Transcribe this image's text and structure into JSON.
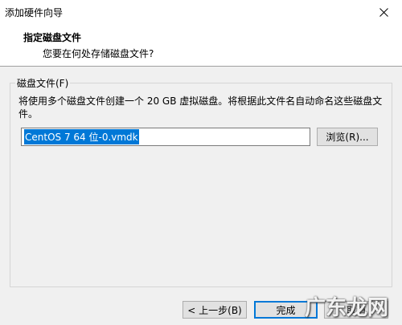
{
  "window": {
    "title": "添加硬件向导",
    "close_icon": "close-icon"
  },
  "header": {
    "title": "指定磁盘文件",
    "subtitle": "您要在何处存储磁盘文件?"
  },
  "disk_file_group": {
    "legend": "磁盘文件(F)",
    "description": "将使用多个磁盘文件创建一个 20 GB 虚拟磁盘。将根据此文件名自动命名这些磁盘文件。",
    "file_name_value": "CentOS 7 64 位-0.vmdk",
    "browse_label": "浏览(R)..."
  },
  "footer": {
    "back_label": "< 上一步(B)",
    "finish_label": "完成",
    "cancel_label": "取消"
  },
  "watermark": {
    "text": "广东龙网"
  }
}
